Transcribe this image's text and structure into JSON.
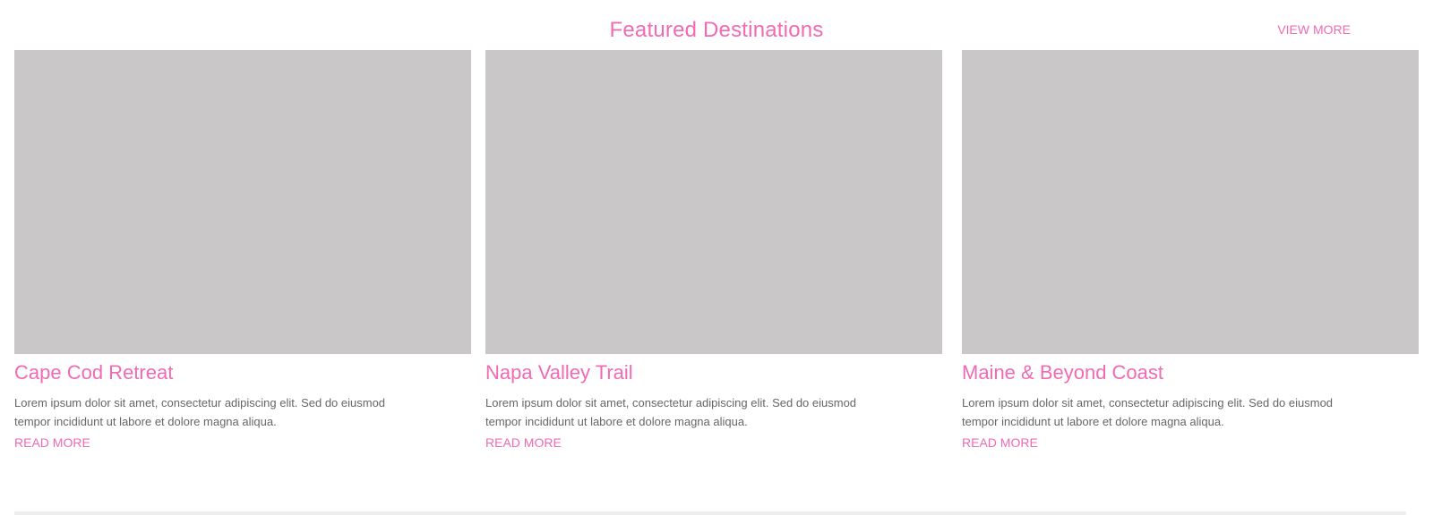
{
  "header": {
    "title": "Featured Destinations",
    "link": "VIEW MORE"
  },
  "cards": [
    {
      "title": "Cape Cod Retreat",
      "description": "Lorem ipsum dolor sit amet, consectetur adipiscing elit. Sed do eiusmod tempor incididunt ut labore et dolore magna aliqua.",
      "link": "READ MORE"
    },
    {
      "title": "Napa Valley Trail",
      "description": "Lorem ipsum dolor sit amet, consectetur adipiscing elit. Sed do eiusmod tempor incididunt ut labore et dolore magna aliqua.",
      "link": "READ MORE"
    },
    {
      "title": "Maine & Beyond Coast",
      "description": "Lorem ipsum dolor sit amet, consectetur adipiscing elit. Sed do eiusmod tempor incididunt ut labore et dolore magna aliqua.",
      "link": "READ MORE"
    }
  ],
  "colors": {
    "accent": "#f06ab4",
    "image_placeholder": "#c9c7c8",
    "divider": "#eeeeee"
  }
}
